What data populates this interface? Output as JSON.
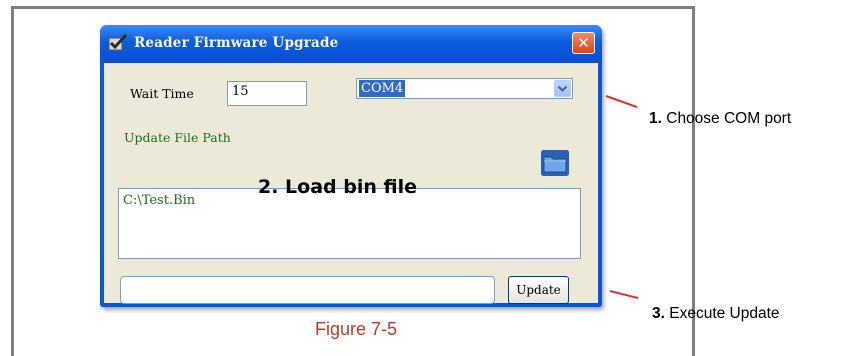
{
  "window": {
    "title": "Reader Firmware Upgrade",
    "close_glyph": "✕"
  },
  "form": {
    "wait_time_label": "Wait Time",
    "wait_time_value": "15",
    "com_port_selected": "COM4",
    "update_file_path_label": "Update File Path",
    "file_path_value": "C:\\Test.Bin",
    "status_value": "",
    "update_button_label": "Update"
  },
  "annotations": {
    "load": "2. Load bin file",
    "com_number": "1.",
    "com_text": " Choose COM port",
    "update_number": "3.",
    "update_text": " Execute Update"
  },
  "caption": "Figure 7-5",
  "icons": {
    "app": "checkmark-app-icon",
    "close": "close-icon",
    "dropdown": "chevron-down-icon",
    "folder": "folder-icon"
  },
  "colors": {
    "title_bar": "#0a56d8",
    "window_face": "#ece9d8",
    "label_green": "#1f6f1f",
    "caption_red": "#c0392b",
    "pointer_red": "#e03030"
  }
}
